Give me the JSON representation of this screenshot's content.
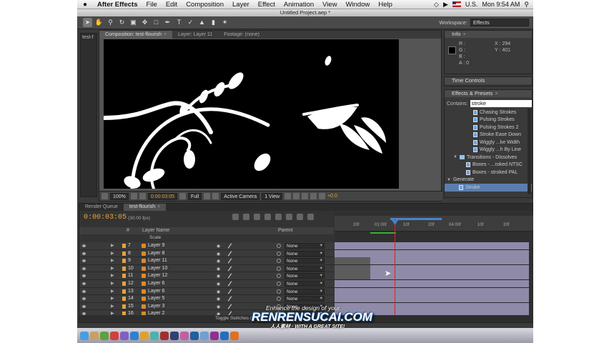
{
  "menubar": {
    "apple": "",
    "app": "After Effects",
    "items": [
      "File",
      "Edit",
      "Composition",
      "Layer",
      "Effect",
      "Animation",
      "View",
      "Window",
      "Help"
    ],
    "locale": "U.S.",
    "clock": "Mon 9:54 AM"
  },
  "window_title": "Untitled Project.aep *",
  "toolbar": {
    "workspace_label": "Workspace:",
    "workspace_value": "Effects",
    "tools": [
      "arrow",
      "hand",
      "zoom",
      "rotate",
      "camera",
      "pan",
      "mask",
      "pen",
      "text",
      "brush",
      "stamp",
      "eraser",
      "puppet"
    ]
  },
  "project_strip": {
    "label": "test-f"
  },
  "viewer": {
    "tabs": [
      {
        "label": "Composition: test-flourish",
        "active": true
      },
      {
        "label": "Layer: Layer 11",
        "active": false
      },
      {
        "label": "Footage: (none)",
        "active": false
      }
    ],
    "comp_label": "test-flourish",
    "zoom": "100%",
    "timecode": "0:00:03:05",
    "resolution": "Full",
    "camera": "Active Camera",
    "views": "1 View",
    "exposure": "+0.0"
  },
  "info": {
    "title": "Info",
    "r": "R :",
    "g": "G :",
    "b": "B :",
    "a": "A : 0",
    "x": "X : 294",
    "y": "Y : 401"
  },
  "time_controls": {
    "title": "Time Controls"
  },
  "effects_presets": {
    "title": "Effects & Presets",
    "contains_label": "Contains:",
    "search_value": "stroke",
    "items": [
      {
        "label": "Chasing Strokes",
        "kind": "preset"
      },
      {
        "label": "Pulsing Strokes",
        "kind": "preset"
      },
      {
        "label": "Pulsing Strokes 2",
        "kind": "preset"
      },
      {
        "label": "Stroke Ease Down",
        "kind": "preset"
      },
      {
        "label": "Wiggly ...ke Width",
        "kind": "preset"
      },
      {
        "label": "Wiggly ...h By Line",
        "kind": "preset"
      },
      {
        "label": "Transitions - Dissolves",
        "kind": "folder"
      },
      {
        "label": "Boxes - ...roked NTSC",
        "kind": "preset"
      },
      {
        "label": "Boxes - stroked PAL",
        "kind": "preset"
      },
      {
        "label": "Generate",
        "kind": "folder"
      },
      {
        "label": "Stroke",
        "kind": "effect",
        "selected": true
      }
    ]
  },
  "timeline": {
    "tabs": [
      {
        "label": "Render Queue",
        "active": false
      },
      {
        "label": "test-flourish",
        "active": true
      }
    ],
    "timecode": "0:00:03:05",
    "fps": "(30.00 fps)",
    "col_layer_name": "Layer Name",
    "col_parent": "Parent",
    "col_num": "#",
    "scale_label": "Scale",
    "layers": [
      {
        "num": "7",
        "name": "Layer 9",
        "parent": "None"
      },
      {
        "num": "8",
        "name": "Layer 8",
        "parent": "None"
      },
      {
        "num": "9",
        "name": "Layer 11",
        "parent": "None"
      },
      {
        "num": "10",
        "name": "Layer 10",
        "parent": "None"
      },
      {
        "num": "11",
        "name": "Layer 12",
        "parent": "None"
      },
      {
        "num": "12",
        "name": "Layer 6",
        "parent": "None"
      },
      {
        "num": "13",
        "name": "Layer 6",
        "parent": "None"
      },
      {
        "num": "14",
        "name": "Layer 5",
        "parent": "None"
      },
      {
        "num": "15",
        "name": "Layer 3",
        "parent": "None"
      },
      {
        "num": "16",
        "name": "Layer 2",
        "parent": "None"
      }
    ],
    "ruler_ticks": [
      "20f",
      "01:00f",
      "10f",
      "20f",
      "04:00f",
      "10f",
      "20f"
    ],
    "toggle_label": "Toggle Switches / Modes"
  },
  "watermark": {
    "line1": "Enhance the design of your",
    "line2": "RENRENSUCAI.COM",
    "line3": "人人素材 · WITH A GREAT SITE!"
  },
  "colors": {
    "accent_orange": "#e8a33a",
    "selection_blue": "#5a7fae",
    "layer_bar": "#8e8aa8",
    "playhead_red": "#e02020"
  }
}
